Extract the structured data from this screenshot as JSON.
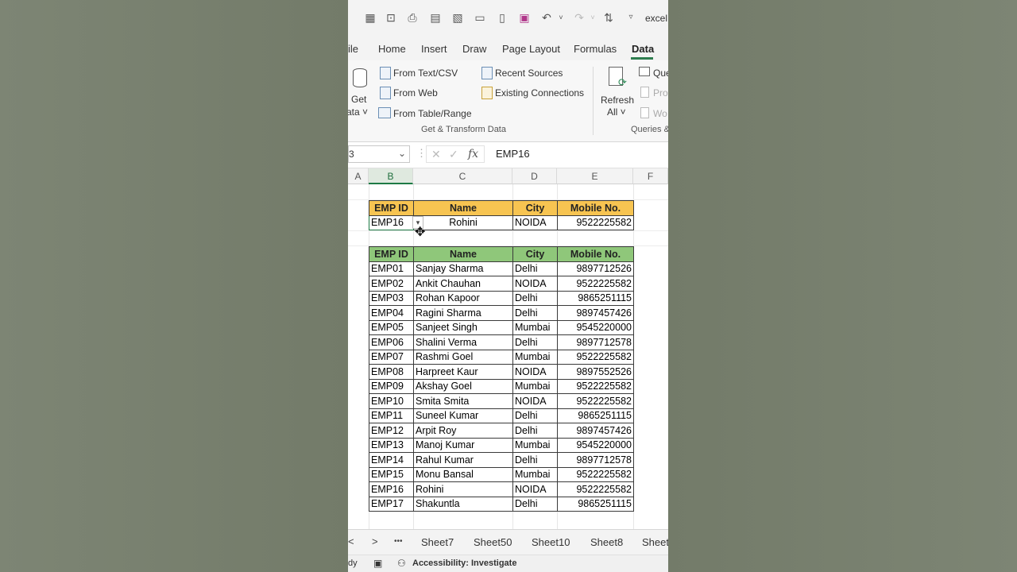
{
  "qat": {
    "filename": "excel",
    "icons": [
      "form-icon",
      "screenshot-icon",
      "print-icon",
      "print-preview-icon",
      "spelling-icon",
      "open-icon",
      "new-icon",
      "save-icon",
      "undo-icon",
      "redo-icon",
      "sort-icon",
      "customize-icon"
    ]
  },
  "tabs": [
    "ile",
    "Home",
    "Insert",
    "Draw",
    "Page Layout",
    "Formulas",
    "Data"
  ],
  "active_tab": "Data",
  "ribbon": {
    "get_data_label_1": "Get",
    "get_data_label_2": "ata ˅",
    "from_text_csv": "From Text/CSV",
    "from_web": "From Web",
    "from_table_range": "From Table/Range",
    "recent_sources": "Recent Sources",
    "existing_connections": "Existing Connections",
    "group_get_transform": "Get & Transform Data",
    "refresh_all_1": "Refresh",
    "refresh_all_2": "All ˅",
    "queries": "Que",
    "properties": "Pro",
    "workbook_links": "Wo",
    "group_queries": "Queries &"
  },
  "formula_bar": {
    "name_box": "3",
    "formula": "EMP16"
  },
  "columns": [
    "A",
    "B",
    "C",
    "D",
    "E",
    "F"
  ],
  "lookup": {
    "headers": [
      "EMP ID",
      "Name",
      "City",
      "Mobile No."
    ],
    "row": [
      "EMP16",
      "Rohini",
      "NOIDA",
      "9522225582"
    ]
  },
  "main_table": {
    "headers": [
      "EMP ID",
      "Name",
      "City",
      "Mobile No."
    ],
    "rows": [
      [
        "EMP01",
        "Sanjay Sharma",
        "Delhi",
        "9897712526"
      ],
      [
        "EMP02",
        "Ankit Chauhan",
        "NOIDA",
        "9522225582"
      ],
      [
        "EMP03",
        "Rohan Kapoor",
        "Delhi",
        "9865251115"
      ],
      [
        "EMP04",
        "Ragini Sharma",
        "Delhi",
        "9897457426"
      ],
      [
        "EMP05",
        "Sanjeet Singh",
        "Mumbai",
        "9545220000"
      ],
      [
        "EMP06",
        "Shalini Verma",
        "Delhi",
        "9897712578"
      ],
      [
        "EMP07",
        "Rashmi Goel",
        "Mumbai",
        "9522225582"
      ],
      [
        "EMP08",
        "Harpreet Kaur",
        "NOIDA",
        "9897552526"
      ],
      [
        "EMP09",
        "Akshay Goel",
        "Mumbai",
        "9522225582"
      ],
      [
        "EMP10",
        "Smita Smita",
        "NOIDA",
        "9522225582"
      ],
      [
        "EMP11",
        "Suneel Kumar",
        "Delhi",
        "9865251115"
      ],
      [
        "EMP12",
        "Arpit Roy",
        "Delhi",
        "9897457426"
      ],
      [
        "EMP13",
        "Manoj Kumar",
        "Mumbai",
        "9545220000"
      ],
      [
        "EMP14",
        "Rahul Kumar",
        "Delhi",
        "9897712578"
      ],
      [
        "EMP15",
        "Monu Bansal",
        "Mumbai",
        "9522225582"
      ],
      [
        "EMP16",
        "Rohini",
        "NOIDA",
        "9522225582"
      ],
      [
        "EMP17",
        "Shakuntla",
        "Delhi",
        "9865251115"
      ]
    ]
  },
  "sheets": [
    "Sheet7",
    "Sheet50",
    "Sheet10",
    "Sheet8",
    "Sheet"
  ],
  "sheet_nav": {
    "prev": "<",
    "next": ">",
    "more": "•••"
  },
  "status": {
    "ready": "dy",
    "accessibility": "Accessibility: Investigate"
  },
  "colors": {
    "lookup_header": "#f7c451",
    "main_header": "#8fc77a",
    "accent": "#1e7a45",
    "save_icon": "#b0368a"
  }
}
